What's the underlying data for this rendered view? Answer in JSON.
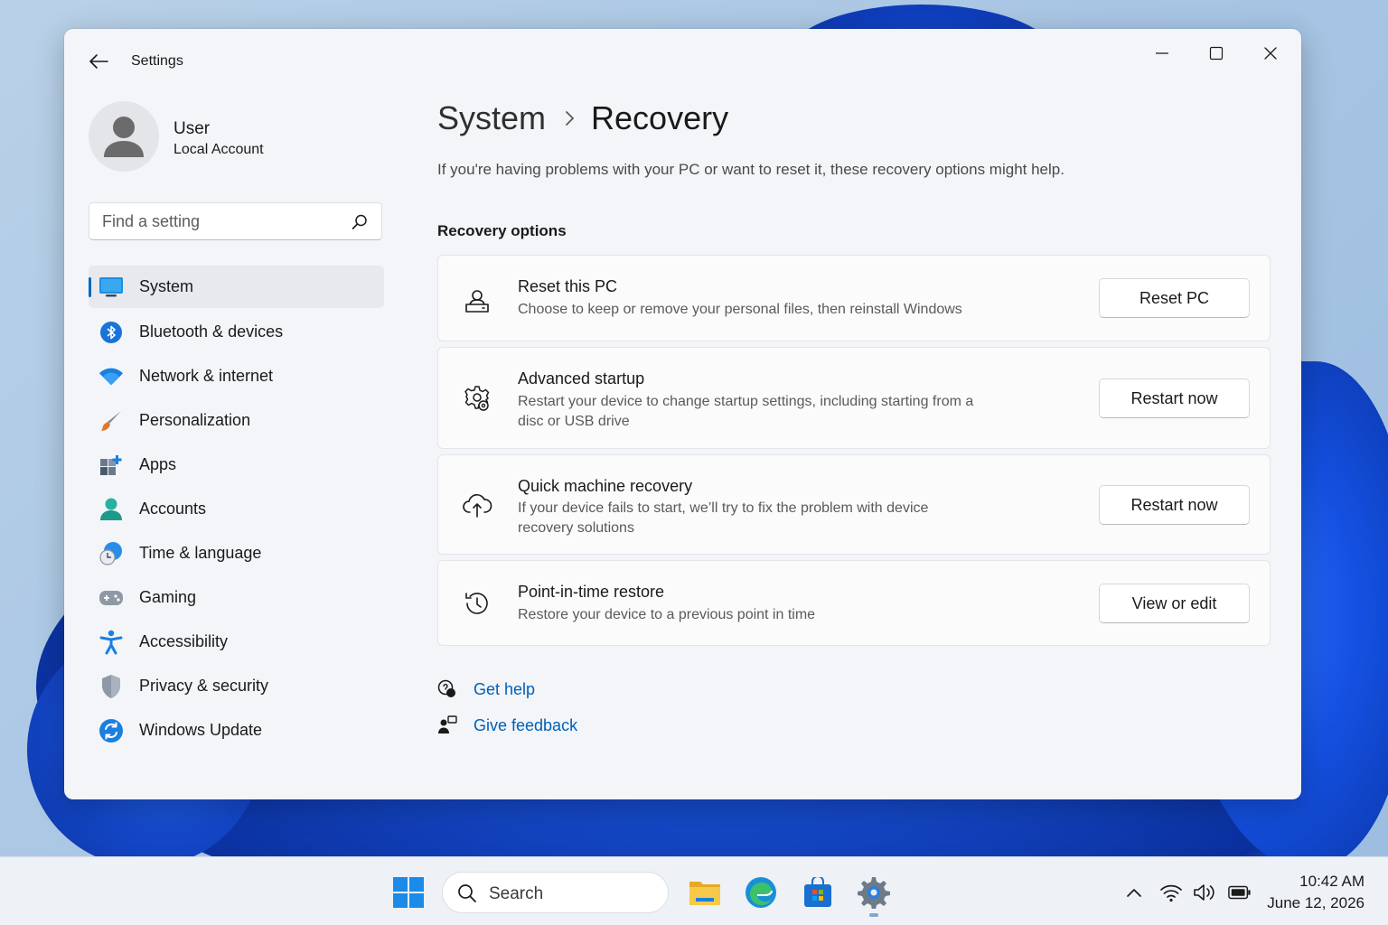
{
  "window": {
    "title": "Settings"
  },
  "profile": {
    "name": "User",
    "account_type": "Local Account"
  },
  "search": {
    "placeholder": "Find a setting"
  },
  "sidebar": {
    "items": [
      {
        "label": "System",
        "icon": "monitor-icon",
        "active": true
      },
      {
        "label": "Bluetooth & devices",
        "icon": "bluetooth-icon"
      },
      {
        "label": "Network & internet",
        "icon": "wifi-icon"
      },
      {
        "label": "Personalization",
        "icon": "paintbrush-icon"
      },
      {
        "label": "Apps",
        "icon": "apps-icon"
      },
      {
        "label": "Accounts",
        "icon": "person-icon"
      },
      {
        "label": "Time & language",
        "icon": "globe-clock-icon"
      },
      {
        "label": "Gaming",
        "icon": "gamepad-icon"
      },
      {
        "label": "Accessibility",
        "icon": "accessibility-icon"
      },
      {
        "label": "Privacy & security",
        "icon": "shield-icon"
      },
      {
        "label": "Windows Update",
        "icon": "update-icon"
      }
    ]
  },
  "main": {
    "breadcrumb_parent": "System",
    "breadcrumb_current": "Recovery",
    "intro": "If you're having problems with your PC or want to reset it, these recovery options might help.",
    "section_title": "Recovery options",
    "options": [
      {
        "title": "Reset this PC",
        "desc": "Choose to keep or remove your personal files, then reinstall Windows",
        "button": "Reset PC",
        "icon": "reset-pc-icon"
      },
      {
        "title": "Advanced startup",
        "desc": "Restart your device to change startup settings, including starting from a disc or USB drive",
        "button": "Restart now",
        "icon": "gear-cog-icon"
      },
      {
        "title": "Quick machine recovery",
        "desc": "If your device fails to start, we’ll try to fix the problem with device recovery solutions",
        "button": "Restart now",
        "icon": "cloud-sync-icon"
      },
      {
        "title": "Point-in-time restore",
        "desc": "Restore your device to a previous point in time",
        "button": "View or edit",
        "icon": "history-icon"
      }
    ],
    "links": [
      {
        "label": "Get help",
        "icon": "help-chat-icon"
      },
      {
        "label": "Give feedback",
        "icon": "feedback-icon"
      }
    ]
  },
  "taskbar": {
    "search_label": "Search",
    "apps": [
      "file-explorer-icon",
      "edge-icon",
      "store-icon",
      "settings-icon"
    ],
    "clock_time": "10:42 AM",
    "clock_date": "June 12, 2026"
  },
  "colors": {
    "accent": "#0067c0",
    "link": "#0060b8"
  }
}
